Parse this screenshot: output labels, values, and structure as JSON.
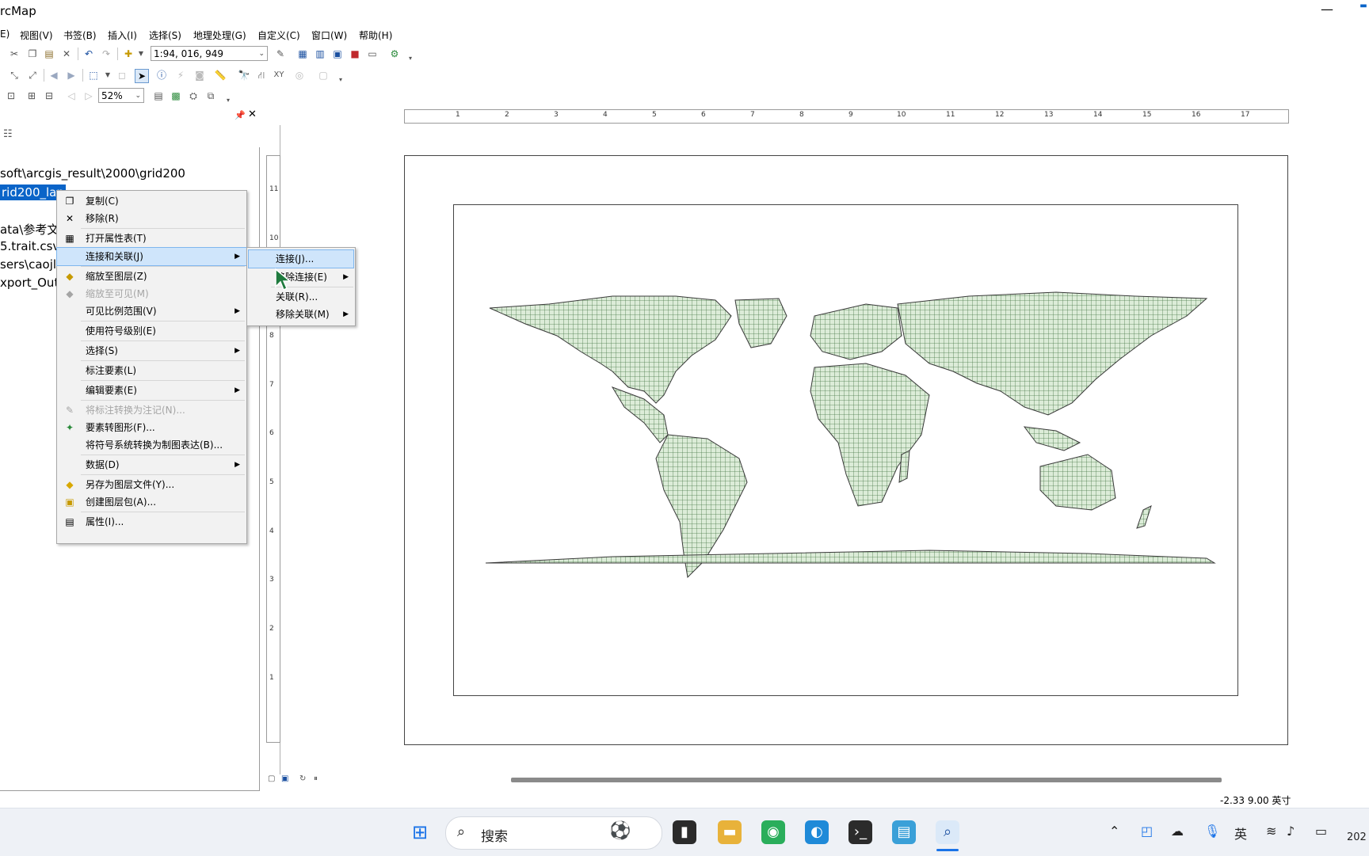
{
  "window": {
    "title": "rcMap",
    "minimize": "—",
    "extra": "▬"
  },
  "menu": [
    "E)",
    "视图(V)",
    "书签(B)",
    "插入(I)",
    "选择(S)",
    "地理处理(G)",
    "自定义(C)",
    "窗口(W)",
    "帮助(H)"
  ],
  "toolbar": {
    "scale": "1:94, 016, 949",
    "zoom": "52%"
  },
  "toc": {
    "lines": [
      "soft\\arcgis_result\\2000\\grid200",
      "ata\\参考文",
      "5.trait.csv",
      "sers\\caojl\\",
      "xport_Out"
    ],
    "selected": "rid200_lan"
  },
  "context_menu": {
    "items": [
      {
        "label": "复制(C)",
        "icon": "copy-icon"
      },
      {
        "label": "移除(R)",
        "icon": "remove-icon"
      },
      {
        "label": "打开属性表(T)",
        "icon": "table-icon"
      },
      {
        "label": "连接和关联(J)",
        "icon": "",
        "submenu": true,
        "highlighted": true
      },
      {
        "label": "缩放至图层(Z)",
        "icon": "zoom-layer-icon"
      },
      {
        "label": "缩放至可见(M)",
        "icon": "zoom-visible-icon",
        "disabled": true
      },
      {
        "label": "可见比例范围(V)",
        "icon": "",
        "submenu": true
      },
      {
        "label": "使用符号级别(E)",
        "icon": ""
      },
      {
        "label": "选择(S)",
        "icon": "",
        "submenu": true
      },
      {
        "label": "标注要素(L)",
        "icon": ""
      },
      {
        "label": "编辑要素(E)",
        "icon": "",
        "submenu": true
      },
      {
        "label": "将标注转换为注记(N)...",
        "icon": "annotation-icon",
        "disabled": true
      },
      {
        "label": "要素转图形(F)...",
        "icon": "graphic-icon"
      },
      {
        "label": "将符号系统转换为制图表达(B)...",
        "icon": ""
      },
      {
        "label": "数据(D)",
        "icon": "",
        "submenu": true
      },
      {
        "label": "另存为图层文件(Y)...",
        "icon": "layer-file-icon"
      },
      {
        "label": "创建图层包(A)...",
        "icon": "package-icon"
      },
      {
        "label": "属性(I)...",
        "icon": "properties-icon"
      }
    ]
  },
  "submenu": {
    "items": [
      {
        "label": "连接(J)...",
        "highlighted": true
      },
      {
        "label": "移除连接(E)",
        "submenu": true
      },
      {
        "label": "关联(R)..."
      },
      {
        "label": "移除关联(M)",
        "submenu": true
      }
    ]
  },
  "ruler": {
    "h": [
      "1",
      "2",
      "3",
      "4",
      "5",
      "6",
      "7",
      "8",
      "9",
      "10",
      "11",
      "12",
      "13",
      "14",
      "15",
      "16",
      "17"
    ],
    "v": [
      "11",
      "10",
      "9",
      "8",
      "7",
      "6",
      "5",
      "4",
      "3",
      "2",
      "1"
    ]
  },
  "status": {
    "coords": "-2.33  9.00 英寸"
  },
  "taskbar": {
    "search_placeholder": "搜索",
    "ime": "英",
    "clock": "202"
  }
}
